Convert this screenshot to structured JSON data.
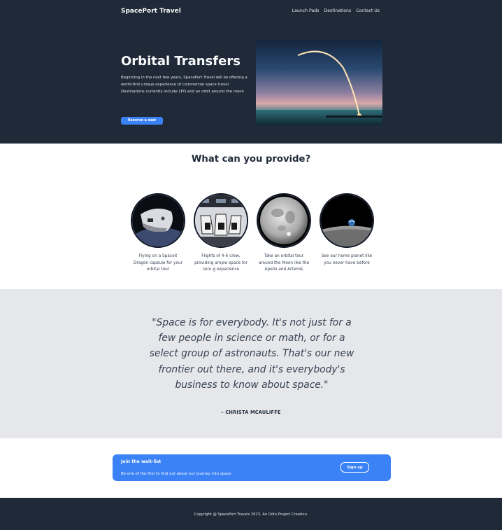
{
  "header": {
    "brand": "SpacePort Travel",
    "nav": [
      "Launch Pads",
      "Destinations",
      "Contact Us"
    ]
  },
  "hero": {
    "title": "Orbital Transfers",
    "text_lines": [
      "Beginning in the next few years, SpacePort Travel will be offering a world-first unique experience of commercial space travel",
      "Destinations currently include LEO and an orbit around the moon"
    ],
    "button_label": "Reserve a seat",
    "image_icon": "rocket-launch-image"
  },
  "provide": {
    "title": "What can you provide?",
    "cards": [
      {
        "icon": "spacex-dragon-capsule-image",
        "text": "Flying on a SpaceX Dragon capsule for your orbital tour"
      },
      {
        "icon": "capsule-interior-image",
        "text": "Flights of 4-6 crew, providing ample space for zero-g experience"
      },
      {
        "icon": "moon-image",
        "text": "Take an orbital tour around the Moon like the Apollo and Artemis missions"
      },
      {
        "icon": "earth-rise-image",
        "text": "See our home planet like you never have before"
      }
    ]
  },
  "quote": {
    "text": "\"Space is for everybody. It's not just for a few people in science or math, or for a select group of astronauts. That's our new frontier out there, and it's everybody's business to know about space.\"",
    "author": "– CHRISTA MCAULIFFE"
  },
  "cta": {
    "title": "Join the wait-list",
    "subtitle": "Be one of the first to find out about our journey into space",
    "button_label": "Sign up"
  },
  "footer": {
    "text": "Copyright @ SpacePort Travels 2023. An Odin Project Creation."
  },
  "colors": {
    "dark": "#1f2937",
    "accent": "#3b82f6",
    "light_gray": "#e5e7eb"
  }
}
